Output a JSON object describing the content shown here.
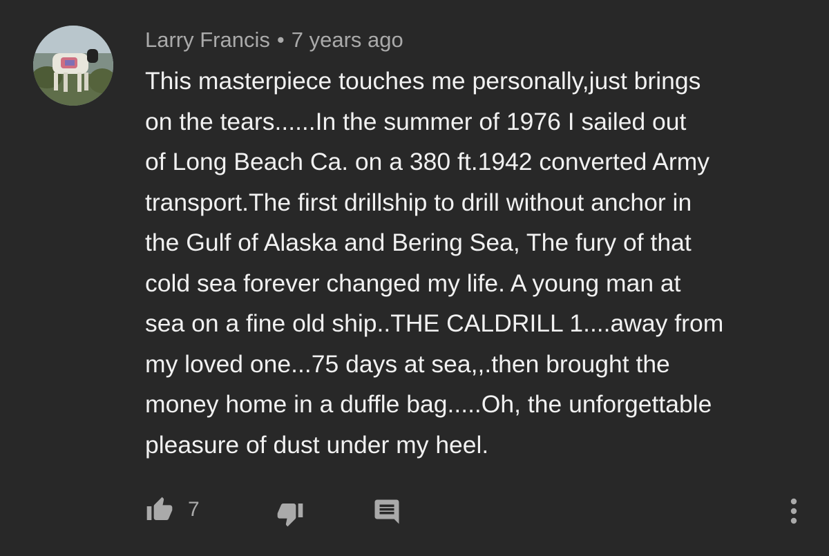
{
  "comment": {
    "author": "Larry Francis",
    "separator": "•",
    "timestamp": "7 years ago",
    "lines": [
      "This masterpiece touches me personally,just brings",
      "on the tears......In the summer of 1976 I sailed out",
      "of Long Beach Ca. on a 380 ft.1942 converted Army",
      "transport.The first drillship to drill without anchor in",
      "the Gulf of Alaska and Bering Sea, The fury of that",
      "cold sea forever changed my life. A young man at",
      "sea on a fine old ship..THE CALDRILL 1....away from",
      "my loved one...75 days at sea,,.then brought the",
      "money home in a duffle bag.....Oh, the unforgettable",
      "pleasure of dust under my heel."
    ]
  },
  "actions": {
    "like_count": "7",
    "like_icon": "thumbs-up-icon",
    "dislike_icon": "thumbs-down-icon",
    "reply_icon": "comment-icon",
    "more_icon": "more-vertical-icon"
  },
  "colors": {
    "background": "#282828",
    "text": "#f1f1f1",
    "secondary_text": "#aaaaaa"
  }
}
